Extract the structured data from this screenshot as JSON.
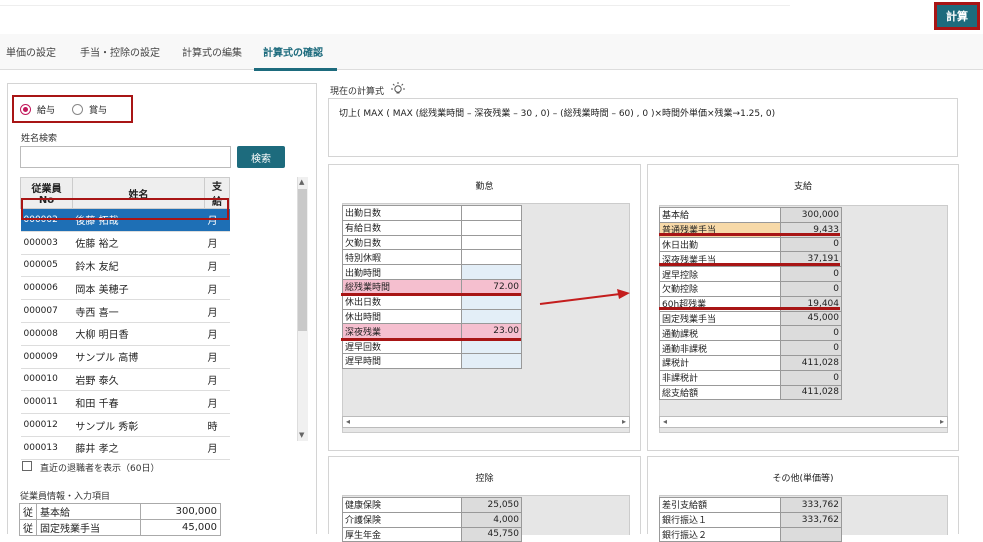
{
  "header": {
    "calc_button": "計算"
  },
  "tabs": [
    "単価の設定",
    "手当・控除の設定",
    "計算式の編集",
    "計算式の確認"
  ],
  "pay_type": {
    "options": [
      "給与",
      "賞与"
    ],
    "selected": "給与"
  },
  "search": {
    "label": "姓名検索",
    "value": "",
    "button": "検索"
  },
  "employees": {
    "headers": [
      "従業員No",
      "姓名",
      "支給"
    ],
    "rows": [
      [
        "000002",
        "後藤 拓哉",
        "月"
      ],
      [
        "000003",
        "佐藤 裕之",
        "月"
      ],
      [
        "000005",
        "鈴木 友紀",
        "月"
      ],
      [
        "000006",
        "岡本 美穂子",
        "月"
      ],
      [
        "000007",
        "寺西 喜一",
        "月"
      ],
      [
        "000008",
        "大柳 明日香",
        "月"
      ],
      [
        "000009",
        "サンプル 高博",
        "月"
      ],
      [
        "000010",
        "岩野 泰久",
        "月"
      ],
      [
        "000011",
        "和田 千春",
        "月"
      ],
      [
        "000012",
        "サンプル 秀彰",
        "時"
      ],
      [
        "000013",
        "藤井 孝之",
        "月"
      ]
    ]
  },
  "retired": {
    "label": "直近の退職者を表示（60日）"
  },
  "employee_info": {
    "label": "従業員情報・入力項目",
    "rows": [
      [
        "従",
        "基本給",
        "300,000"
      ],
      [
        "従",
        "固定残業手当",
        "45,000"
      ]
    ]
  },
  "formula": {
    "label": "現在の計算式",
    "text": "切上( MAX ( MAX (総残業時間 – 深夜残業 – 30 , 0) – (総残業時間 – 60) , 0 )×時間外単価×残業→1.25, 0)"
  },
  "attendance": {
    "title": "勤怠",
    "rows": [
      [
        "出勤日数",
        ""
      ],
      [
        "有給日数",
        ""
      ],
      [
        "欠勤日数",
        ""
      ],
      [
        "特別休暇",
        ""
      ],
      [
        "出勤時間",
        ""
      ],
      [
        "総残業時間",
        "72.00"
      ],
      [
        "休出日数",
        ""
      ],
      [
        "休出時間",
        ""
      ],
      [
        "深夜残業",
        "23.00"
      ],
      [
        "遅早回数",
        ""
      ],
      [
        "遅早時間",
        ""
      ]
    ]
  },
  "payment": {
    "title": "支給",
    "rows": [
      [
        "基本給",
        "300,000"
      ],
      [
        "普通残業手当",
        "9,433"
      ],
      [
        "休日出勤",
        "0"
      ],
      [
        "深夜残業手当",
        "37,191"
      ],
      [
        "遅早控除",
        "0"
      ],
      [
        "欠勤控除",
        "0"
      ],
      [
        "60h超残業",
        "19,404"
      ],
      [
        "固定残業手当",
        "45,000"
      ],
      [
        "通勤課税",
        "0"
      ],
      [
        "通勤非課税",
        "0"
      ],
      [
        "課税計",
        "411,028"
      ],
      [
        "非課税計",
        "0"
      ],
      [
        "総支給額",
        "411,028"
      ]
    ]
  },
  "deduction": {
    "title": "控除",
    "rows": [
      [
        "健康保険",
        "25,050"
      ],
      [
        "介護保険",
        "4,000"
      ],
      [
        "厚生年金",
        "45,750"
      ]
    ]
  },
  "other": {
    "title": "その他(単価等)",
    "rows": [
      [
        "差引支給額",
        "333,762"
      ],
      [
        "銀行振込１",
        "333,762"
      ],
      [
        "銀行振込２",
        ""
      ]
    ]
  },
  "colors": {
    "accent": "#1d6b7d",
    "highlight_red": "#a81515",
    "selected_row": "#1e6fb5"
  }
}
